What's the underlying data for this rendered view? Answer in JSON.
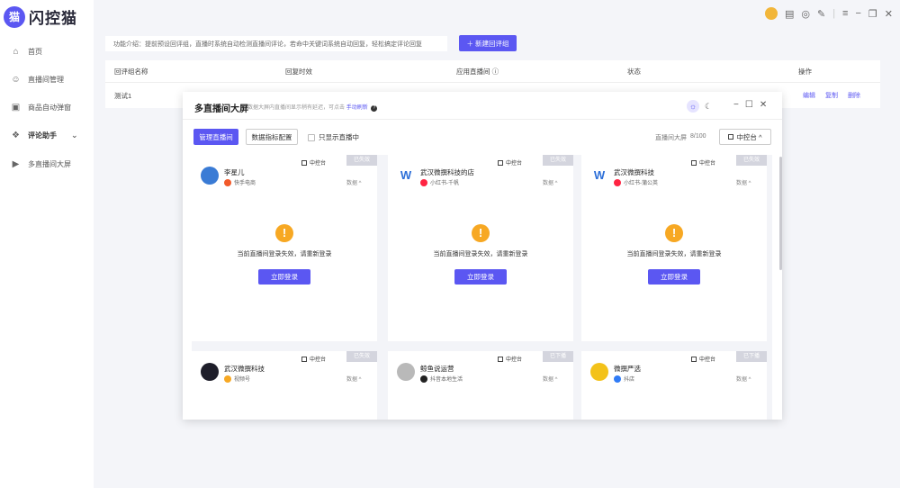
{
  "app": {
    "name": "闪控猫",
    "logo_glyph": "猫"
  },
  "sidebar": {
    "items": [
      {
        "label": "首页",
        "icon": "home-icon",
        "glyph": "⌂"
      },
      {
        "label": "直播间管理",
        "icon": "live-room-icon",
        "glyph": "☺"
      },
      {
        "label": "商品自动弹窗",
        "icon": "product-popup-icon",
        "glyph": "▣"
      },
      {
        "label": "评论助手",
        "icon": "comment-assistant-icon",
        "glyph": "❖",
        "active": true,
        "chevron": "⌄"
      },
      {
        "label": "多直播间大屏",
        "icon": "multi-screen-icon",
        "glyph": "▶"
      }
    ]
  },
  "topbar": {
    "icons": [
      "user-avatar",
      "clipboard-icon",
      "headset-icon",
      "edit-icon",
      "menu-icon",
      "minimize-icon",
      "restore-icon",
      "close-icon"
    ]
  },
  "main": {
    "intro": "功能介绍：提前预设回评组，直播时系统自动检测直播间评论，若命中关键词系统自动回复，轻松搞定评论回复",
    "new_button": "＋  新建回评组",
    "table": {
      "headers": [
        "回评组名称",
        "回复时效",
        "应用直播间 ⓘ",
        "状态",
        "操作"
      ],
      "rows": [
        {
          "name": "测试1",
          "actions": [
            "编辑",
            "复制",
            "删除"
          ]
        }
      ]
    }
  },
  "modal": {
    "title": "多直播间大屏",
    "subtitle": "数据大屏内直播间显示稍有延迟，可点击",
    "subtitle_link": "手动刷新",
    "manage_button": "管理直播间",
    "config_button": "数据指标配置",
    "only_live_label": "只显示直播中",
    "count_label": "直播间大屏",
    "count_value": "8/100",
    "control_panel": "中控台 ^",
    "cards": [
      {
        "name": "李星儿",
        "platform": "快手电商",
        "badge": "已失效",
        "control": "中控台",
        "data": "数据 ^",
        "msg": "当前直播间登录失效，请重新登录",
        "btn": "立即登录",
        "avatar_color": "#3a7bd5",
        "pcolor": "#f25a2a"
      },
      {
        "name": "武汉微撰科技的店",
        "platform": "小红书-千帆",
        "badge": "已失效",
        "control": "中控台",
        "data": "数据 ^",
        "msg": "当前直播间登录失效，请重新登录",
        "btn": "立即登录",
        "avatar_color": "#2d6fd8",
        "pcolor": "#ff2442"
      },
      {
        "name": "武汉微撰科技",
        "platform": "小红书-蒲公英",
        "badge": "已失效",
        "control": "中控台",
        "data": "数据 ^",
        "msg": "当前直播间登录失效，请重新登录",
        "btn": "立即登录",
        "avatar_color": "#2d6fd8",
        "pcolor": "#ff2442"
      },
      {
        "name": "武汉微撰科技",
        "platform": "视频号",
        "badge": "已失效",
        "control": "中控台",
        "data": "数据 ^",
        "avatar_color": "#1e1e2a",
        "pcolor": "#f7a823"
      },
      {
        "name": "鲸鱼说运营",
        "platform": "抖音本地生活",
        "badge": "已下播",
        "control": "中控台",
        "data": "数据 ^",
        "avatar_color": "#b9b9b9",
        "pcolor": "#222"
      },
      {
        "name": "微撰严选",
        "platform": "抖店",
        "badge": "已下播",
        "control": "中控台",
        "data": "数据 ^",
        "avatar_color": "#f3c21a",
        "pcolor": "#2f7bf6"
      }
    ]
  }
}
